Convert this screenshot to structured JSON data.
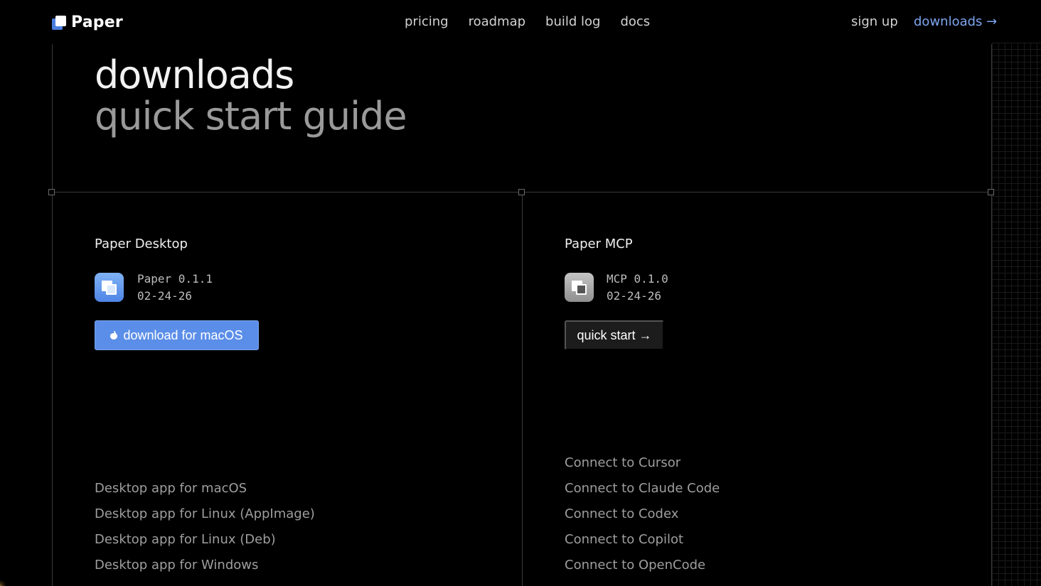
{
  "header": {
    "logo_text": "Paper",
    "nav": [
      "pricing",
      "roadmap",
      "build log",
      "docs"
    ],
    "signup_label": "sign up",
    "downloads_label": "downloads →"
  },
  "hero": {
    "title": "downloads",
    "subtitle": "quick start guide"
  },
  "desktop": {
    "title": "Paper Desktop",
    "version": "Paper 0.1.1",
    "date": "02-24-26",
    "download_label": "download for macOS",
    "links": [
      "Desktop app for macOS",
      "Desktop app for Linux (AppImage)",
      "Desktop app for Linux (Deb)",
      "Desktop app for Windows"
    ]
  },
  "mcp": {
    "title": "Paper MCP",
    "version": "MCP 0.1.0",
    "date": "02-24-26",
    "quickstart_label": "quick start →",
    "links": [
      "Connect to Cursor",
      "Connect to Claude Code",
      "Connect to Codex",
      "Connect to Copilot",
      "Connect to OpenCode"
    ]
  },
  "colors": {
    "background": "#000000",
    "accent": "#5b8ee8",
    "link_accent": "#7ea6f0",
    "muted_text": "#9e9e9e"
  },
  "icons": {
    "logo": "paper-logo-icon",
    "desktop_app": "paper-app-icon",
    "mcp_app": "mcp-app-icon",
    "download": "apple-icon"
  }
}
